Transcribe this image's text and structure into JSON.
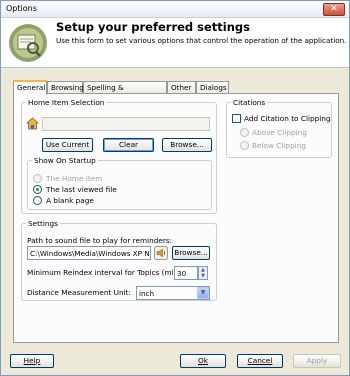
{
  "window": {
    "title": "Options",
    "close_glyph": "✕"
  },
  "header": {
    "title": "Setup your preferred settings",
    "subtitle": "Use this form to set various options that control the operation of the application."
  },
  "tabs": [
    "General",
    "Browsing",
    "Spelling & Thesaurus",
    "Other",
    "Dialogs"
  ],
  "home_item": {
    "legend": "Home Item Selection",
    "value": "",
    "icon": "home-icon",
    "use_current": "Use Current",
    "clear": "Clear",
    "browse": "Browse..."
  },
  "startup": {
    "legend": "Show On Startup",
    "options": [
      "The Home Item",
      "The last viewed file",
      "A blank page"
    ],
    "selected": "The last viewed file"
  },
  "citations": {
    "legend": "Citations",
    "add_label": "Add Citation to Clipping",
    "above": "Above Clipping",
    "below": "Below Clipping"
  },
  "settings": {
    "legend": "Settings",
    "sound_label": "Path to sound file to play for reminders:",
    "sound_path": "C:\\Windows\\Media\\Windows XP No",
    "sound_icon": "speaker-icon",
    "browse": "Browse...",
    "reindex_label": "Minimum Reindex interval for Topics (minutes):",
    "reindex_value": "30",
    "distance_label": "Distance Measurement Unit:",
    "distance_value": "inch"
  },
  "footer": {
    "help": "Help",
    "ok": "Ok",
    "cancel": "Cancel",
    "apply": "Apply"
  }
}
